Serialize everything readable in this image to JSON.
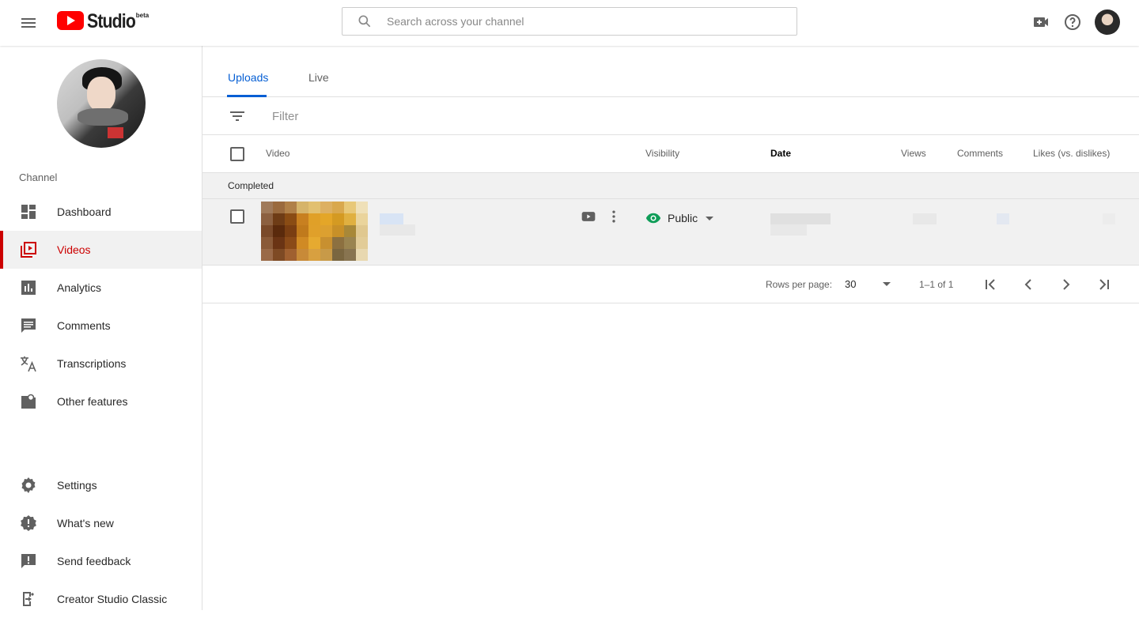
{
  "header": {
    "logo_text": "Studio",
    "logo_badge": "beta",
    "search_placeholder": "Search across your channel",
    "icons": [
      "menu-icon",
      "youtube-play-icon",
      "search-icon",
      "create-video-icon",
      "help-icon",
      "account-avatar"
    ]
  },
  "sidebar": {
    "section_label": "Channel",
    "items": [
      {
        "label": "Dashboard",
        "icon": "dashboard-icon",
        "active": false
      },
      {
        "label": "Videos",
        "icon": "videos-icon",
        "active": true
      },
      {
        "label": "Analytics",
        "icon": "analytics-icon",
        "active": false
      },
      {
        "label": "Comments",
        "icon": "comments-icon",
        "active": false
      },
      {
        "label": "Transcriptions",
        "icon": "translate-icon",
        "active": false
      },
      {
        "label": "Other features",
        "icon": "other-features-icon",
        "active": false
      }
    ],
    "bottom_items": [
      {
        "label": "Settings",
        "icon": "settings-icon"
      },
      {
        "label": "What's new",
        "icon": "whats-new-icon"
      },
      {
        "label": "Send feedback",
        "icon": "feedback-icon"
      },
      {
        "label": "Creator Studio Classic",
        "icon": "exit-icon"
      }
    ],
    "active_color": "#cc0000"
  },
  "main": {
    "tabs": [
      {
        "label": "Uploads",
        "active": true
      },
      {
        "label": "Live",
        "active": false
      }
    ],
    "filter_placeholder": "Filter",
    "columns": {
      "video": "Video",
      "visibility": "Visibility",
      "date": "Date",
      "views": "Views",
      "comments": "Comments",
      "likes": "Likes (vs. dislikes)"
    },
    "group_label": "Completed",
    "row": {
      "visibility": "Public",
      "visibility_color": "#0f9d58"
    },
    "pagination": {
      "rows_per_page_label": "Rows per page:",
      "rows_per_page": "30",
      "range": "1–1 of 1"
    },
    "accent_color": "#065fd4"
  }
}
